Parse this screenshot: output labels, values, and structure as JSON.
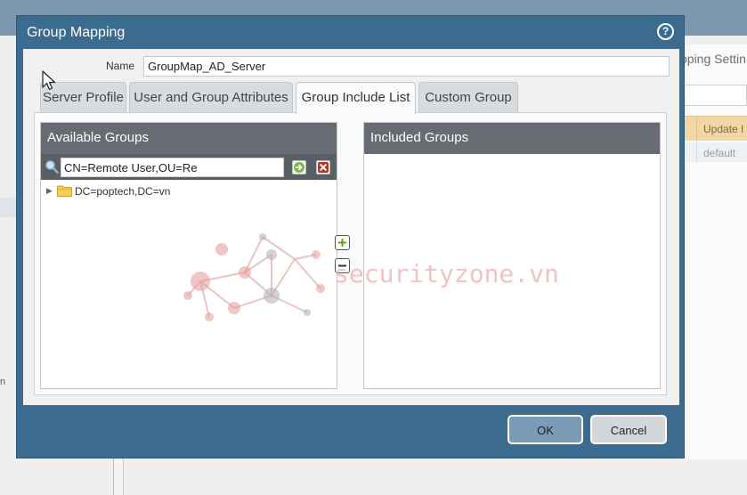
{
  "background": {
    "right_panel_title": "pping Settin",
    "right_table_header": "Update I",
    "right_table_row": "default",
    "left_text": "n"
  },
  "dialog": {
    "title": "Group Mapping",
    "help_icon": "question-mark-icon",
    "name_label": "Name",
    "name_value": "GroupMap_AD_Server",
    "tabs": [
      {
        "label": "Server Profile"
      },
      {
        "label": "User and Group Attributes"
      },
      {
        "label": "Group Include List",
        "active": true
      },
      {
        "label": "Custom Group"
      }
    ],
    "available_groups": {
      "title": "Available Groups",
      "search_value": "CN=Remote User,OU=Re",
      "tree_items": [
        {
          "label": "DC=poptech,DC=vn",
          "icon": "folder-icon",
          "expanded": false
        }
      ]
    },
    "included_groups": {
      "title": "Included Groups"
    },
    "buttons": {
      "ok": "OK",
      "cancel": "Cancel"
    },
    "watermark": "securityzone.vn"
  },
  "colors": {
    "dialog_frame": "#3b6b8e",
    "panel_header": "#676c72",
    "ok_button": "#7a9cb7",
    "folder": "#f3cd55"
  }
}
